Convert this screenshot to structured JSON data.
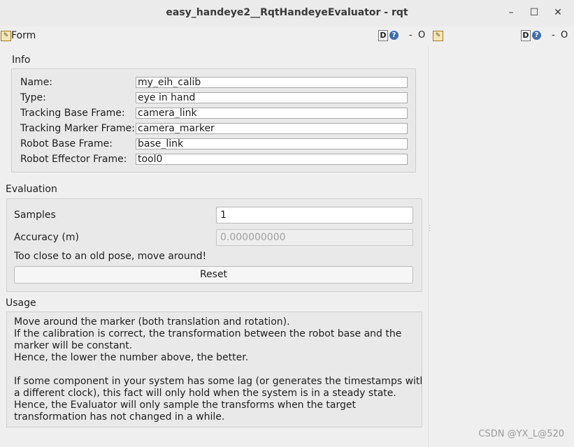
{
  "window": {
    "title": "easy_handeye2__RqtHandeyeEvaluator - rqt",
    "minimize_glyph": "–",
    "maximize_glyph": "☐",
    "close_glyph": "✕"
  },
  "dock_left": {
    "title": "Form",
    "d_label": "D",
    "help_glyph": "?",
    "dash_glyph": "-",
    "close_glyph": "O",
    "icon": "pencil-icon"
  },
  "dock_right": {
    "d_label": "D",
    "help_glyph": "?",
    "dash_glyph": "-",
    "close_glyph": "O",
    "icon": "pencil-icon"
  },
  "info": {
    "group_label": "Info",
    "rows": [
      {
        "label": "Name:",
        "value": "my_eih_calib"
      },
      {
        "label": "Type:",
        "value": "eye in hand"
      },
      {
        "label": "Tracking Base Frame:",
        "value": "camera_link"
      },
      {
        "label": "Tracking Marker Frame:",
        "value": "camera_marker"
      },
      {
        "label": "Robot Base Frame:",
        "value": "base_link"
      },
      {
        "label": "Robot Effector Frame:",
        "value": "tool0"
      }
    ]
  },
  "evaluation": {
    "group_label": "Evaluation",
    "samples_label": "Samples",
    "samples_value": "1",
    "accuracy_label": "Accuracy (m)",
    "accuracy_value": "0.000000000",
    "status": "Too close to an old pose, move around!",
    "reset_label": "Reset"
  },
  "usage": {
    "group_label": "Usage",
    "lines": [
      "Move around the marker (both translation and rotation).",
      "If the calibration is correct, the transformation between the robot base and the",
      "marker will be constant.",
      "Hence, the lower the number above, the better.",
      "",
      "If some component in your system has some lag (or generates the timestamps with",
      "a different clock), this fact will only hold when the system is in a steady state.",
      "Hence, the Evaluator will only sample the transforms when the target",
      "transformation has not changed in a while."
    ]
  },
  "watermark": "CSDN @YX_L@520",
  "colors": {
    "window_bg": "#efefef",
    "group_bg": "#e9e9e9",
    "help_icon": "#3f6fb0"
  }
}
